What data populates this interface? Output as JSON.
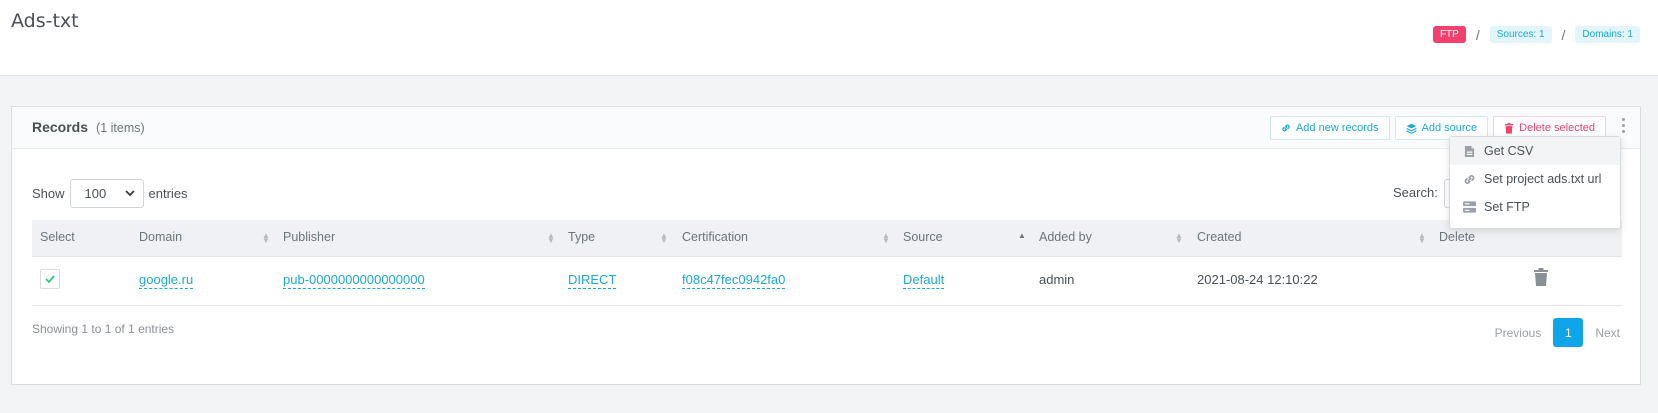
{
  "header": {
    "title": "Ads-txt",
    "breadcrumb": [
      {
        "label": "FTP",
        "variant": "danger"
      },
      {
        "label": "Sources: 1",
        "variant": "info"
      },
      {
        "label": "Domains: 1",
        "variant": "info"
      }
    ],
    "separator": "/"
  },
  "card": {
    "title": "Records",
    "count": "(1 items)",
    "buttons": {
      "add_records": "Add new records",
      "add_source": "Add source",
      "delete_selected": "Delete selected"
    }
  },
  "controls": {
    "show_label": "Show",
    "page_size": "100",
    "entries_label": "entries",
    "search_label": "Search:"
  },
  "table": {
    "columns": [
      "Select",
      "Domain",
      "Publisher",
      "Type",
      "Certification",
      "Source",
      "Added by",
      "Created",
      "Delete"
    ],
    "rows": [
      {
        "domain": "google.ru",
        "publisher": "pub-0000000000000000",
        "type": "DIRECT",
        "certification": "f08c47fec0942fa0",
        "source": "Default",
        "added_by": "admin",
        "created": "2021-08-24 12:10:22",
        "selected": true
      }
    ]
  },
  "footer": {
    "info": "Showing 1 to 1 of 1 entries",
    "previous": "Previous",
    "current_page": "1",
    "next": "Next"
  },
  "dropdown_menu": {
    "items": [
      {
        "label": "Get CSV",
        "icon": "csv-file-icon"
      },
      {
        "label": "Set project ads.txt url",
        "icon": "link-icon"
      },
      {
        "label": "Set FTP",
        "icon": "server-icon"
      }
    ]
  },
  "colors": {
    "accent": "#19a9d6",
    "danger": "#f1416c",
    "primary_page": "#0ea5e9"
  }
}
